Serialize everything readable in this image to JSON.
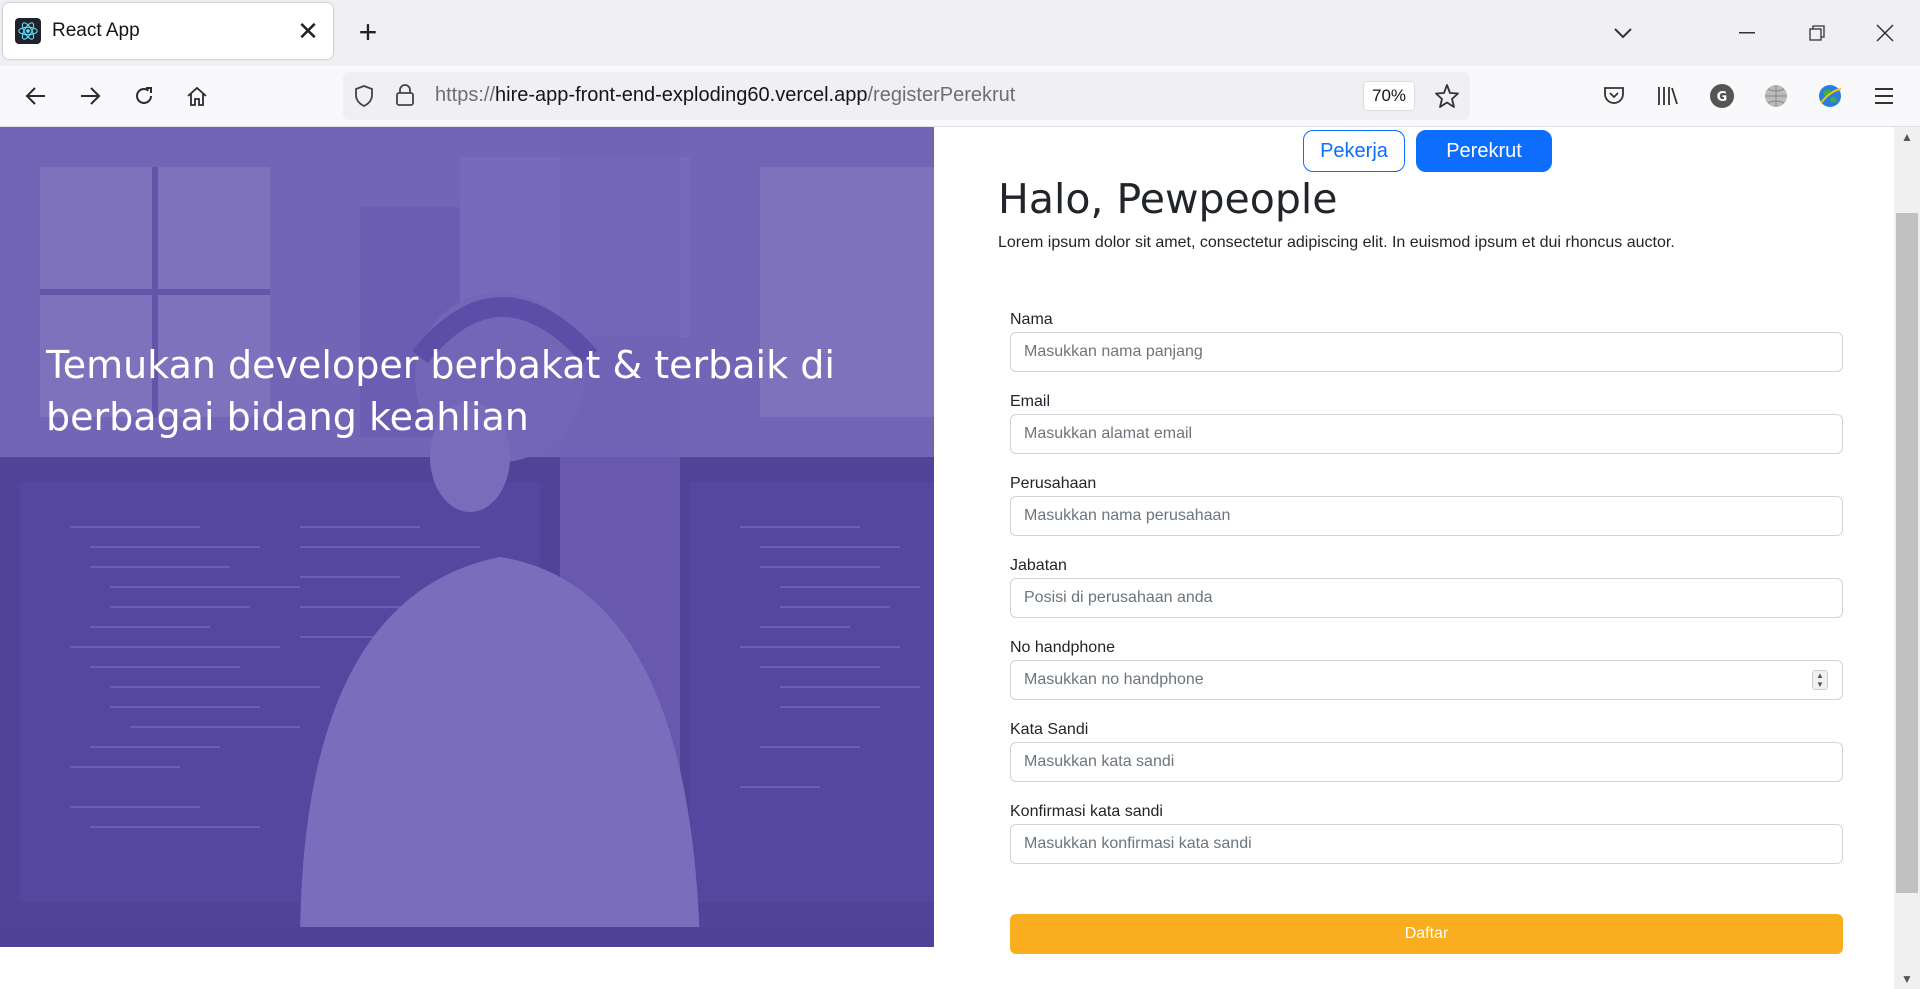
{
  "browser": {
    "tab_title": "React App",
    "tab_close": "✕",
    "new_tab": "+",
    "url_scheme": "https://",
    "url_host": "hire-app-front-end-exploding60.vercel.app",
    "url_path": "/registerPerekrut",
    "zoom": "70%"
  },
  "hero": {
    "title": "Temukan developer berbakat & terbaik di berbagai bidang keahlian"
  },
  "switcher": {
    "pekerja": "Pekerja",
    "perekrut": "Perekrut"
  },
  "form": {
    "greeting": "Halo, Pewpeople",
    "subtext": "Lorem ipsum dolor sit amet, consectetur adipiscing elit. In euismod ipsum et dui rhoncus auctor.",
    "fields": [
      {
        "label": "Nama",
        "placeholder": "Masukkan nama panjang"
      },
      {
        "label": "Email",
        "placeholder": "Masukkan alamat email"
      },
      {
        "label": "Perusahaan",
        "placeholder": "Masukkan nama perusahaan"
      },
      {
        "label": "Jabatan",
        "placeholder": "Posisi di perusahaan anda"
      },
      {
        "label": "No handphone",
        "placeholder": "Masukkan no handphone"
      },
      {
        "label": "Kata Sandi",
        "placeholder": "Masukkan kata sandi"
      },
      {
        "label": "Konfirmasi kata sandi",
        "placeholder": "Masukkan konfirmasi kata sandi"
      }
    ],
    "submit": "Daftar"
  }
}
